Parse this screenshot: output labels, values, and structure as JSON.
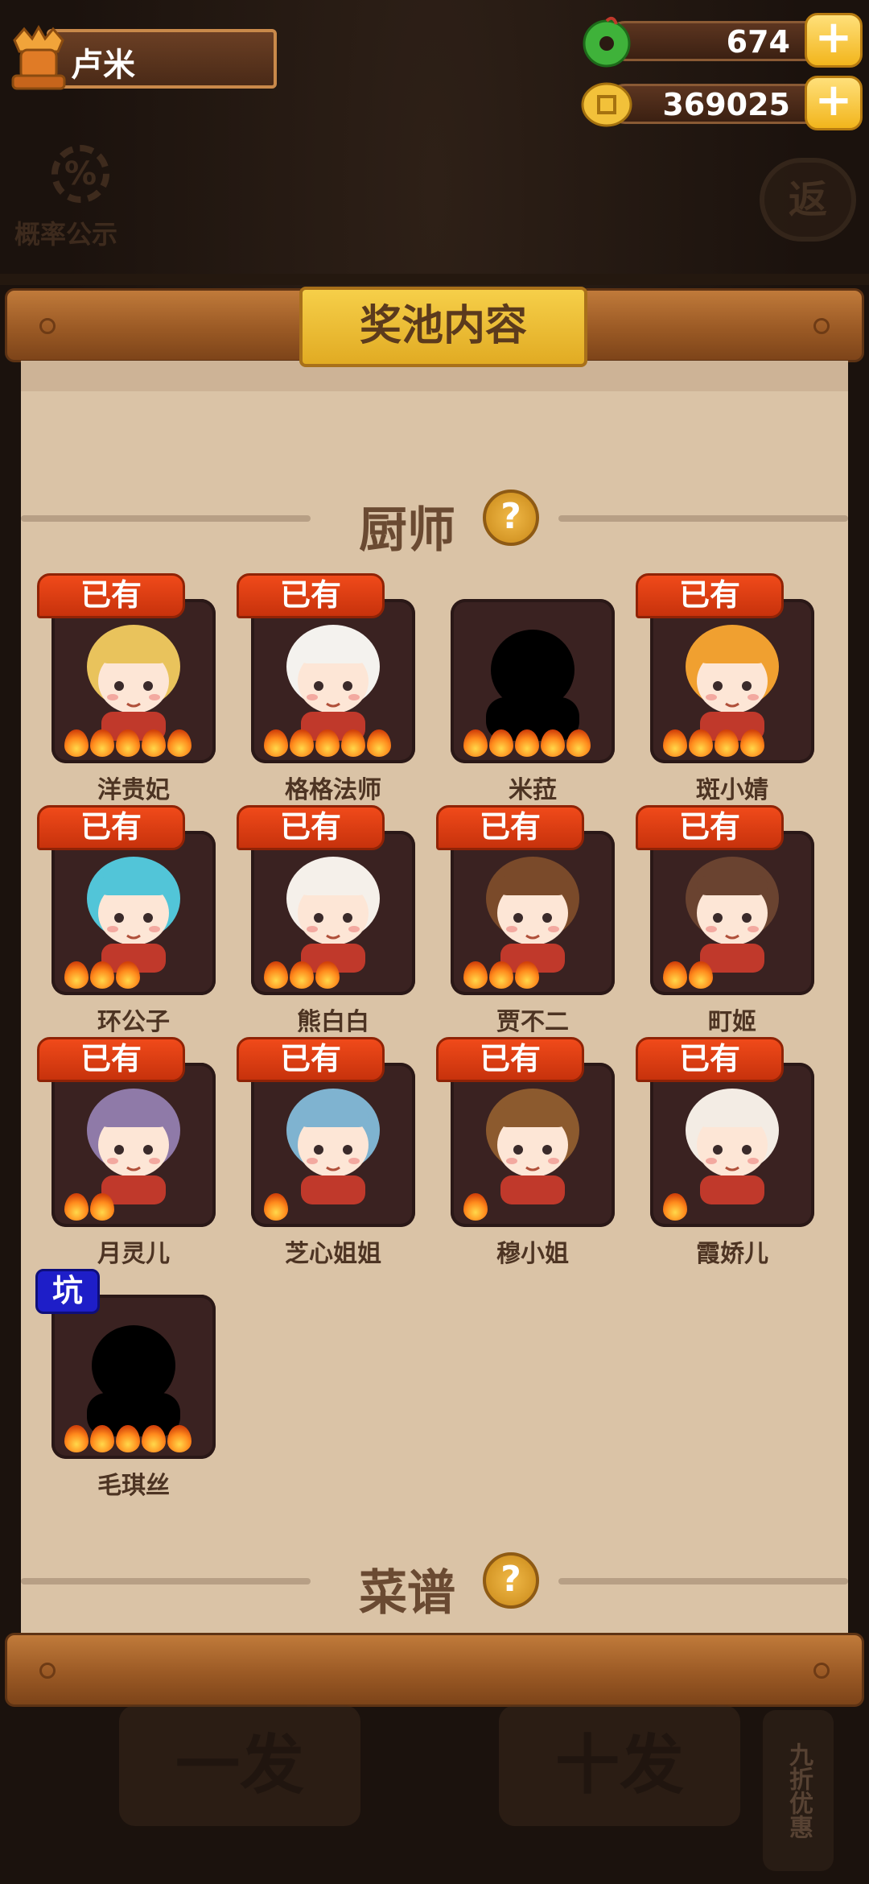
{
  "player": {
    "name": "卢米"
  },
  "resources": {
    "jade": "674",
    "coins": "369025",
    "plus": "+"
  },
  "odds_label": "概率公示",
  "odds_symbol": "%",
  "back_label": "返",
  "pool_title": "奖池内容",
  "sections": {
    "chefs": "厨师",
    "recipes": "菜谱",
    "help": "?"
  },
  "tags": {
    "owned": "已有",
    "pit": "坑"
  },
  "chefs": [
    {
      "name": "洋贵妃",
      "tag": "已有",
      "stars": 5,
      "hair": "#e9c35c",
      "silhouette": false
    },
    {
      "name": "格格法师",
      "tag": "已有",
      "stars": 5,
      "hair": "#f4f2ee",
      "silhouette": false
    },
    {
      "name": "米菈",
      "tag": "",
      "stars": 5,
      "hair": "#000000",
      "silhouette": true
    },
    {
      "name": "斑小婧",
      "tag": "已有",
      "stars": 4,
      "hair": "#f0a030",
      "silhouette": false
    },
    {
      "name": "环公子",
      "tag": "已有",
      "stars": 3,
      "hair": "#52c5d8",
      "silhouette": false
    },
    {
      "name": "熊白白",
      "tag": "已有",
      "stars": 3,
      "hair": "#f5f0ea",
      "silhouette": false
    },
    {
      "name": "贾不二",
      "tag": "已有",
      "stars": 3,
      "hair": "#7a4a2a",
      "silhouette": false
    },
    {
      "name": "町姬",
      "tag": "已有",
      "stars": 2,
      "hair": "#6a4330",
      "silhouette": false
    },
    {
      "name": "月灵儿",
      "tag": "已有",
      "stars": 2,
      "hair": "#8f7aa8",
      "silhouette": false
    },
    {
      "name": "芝心姐姐",
      "tag": "已有",
      "stars": 1,
      "hair": "#7fb3d0",
      "silhouette": false
    },
    {
      "name": "穆小姐",
      "tag": "已有",
      "stars": 1,
      "hair": "#8c5a2e",
      "silhouette": false
    },
    {
      "name": "霞娇儿",
      "tag": "已有",
      "stars": 1,
      "hair": "#f3ece4",
      "silhouette": false
    },
    {
      "name": "毛琪丝",
      "tag": "坑",
      "stars": 5,
      "hair": "#000000",
      "silhouette": true
    }
  ],
  "bottom": {
    "single": "一发",
    "ten": "十发",
    "discount": "九折优惠"
  }
}
